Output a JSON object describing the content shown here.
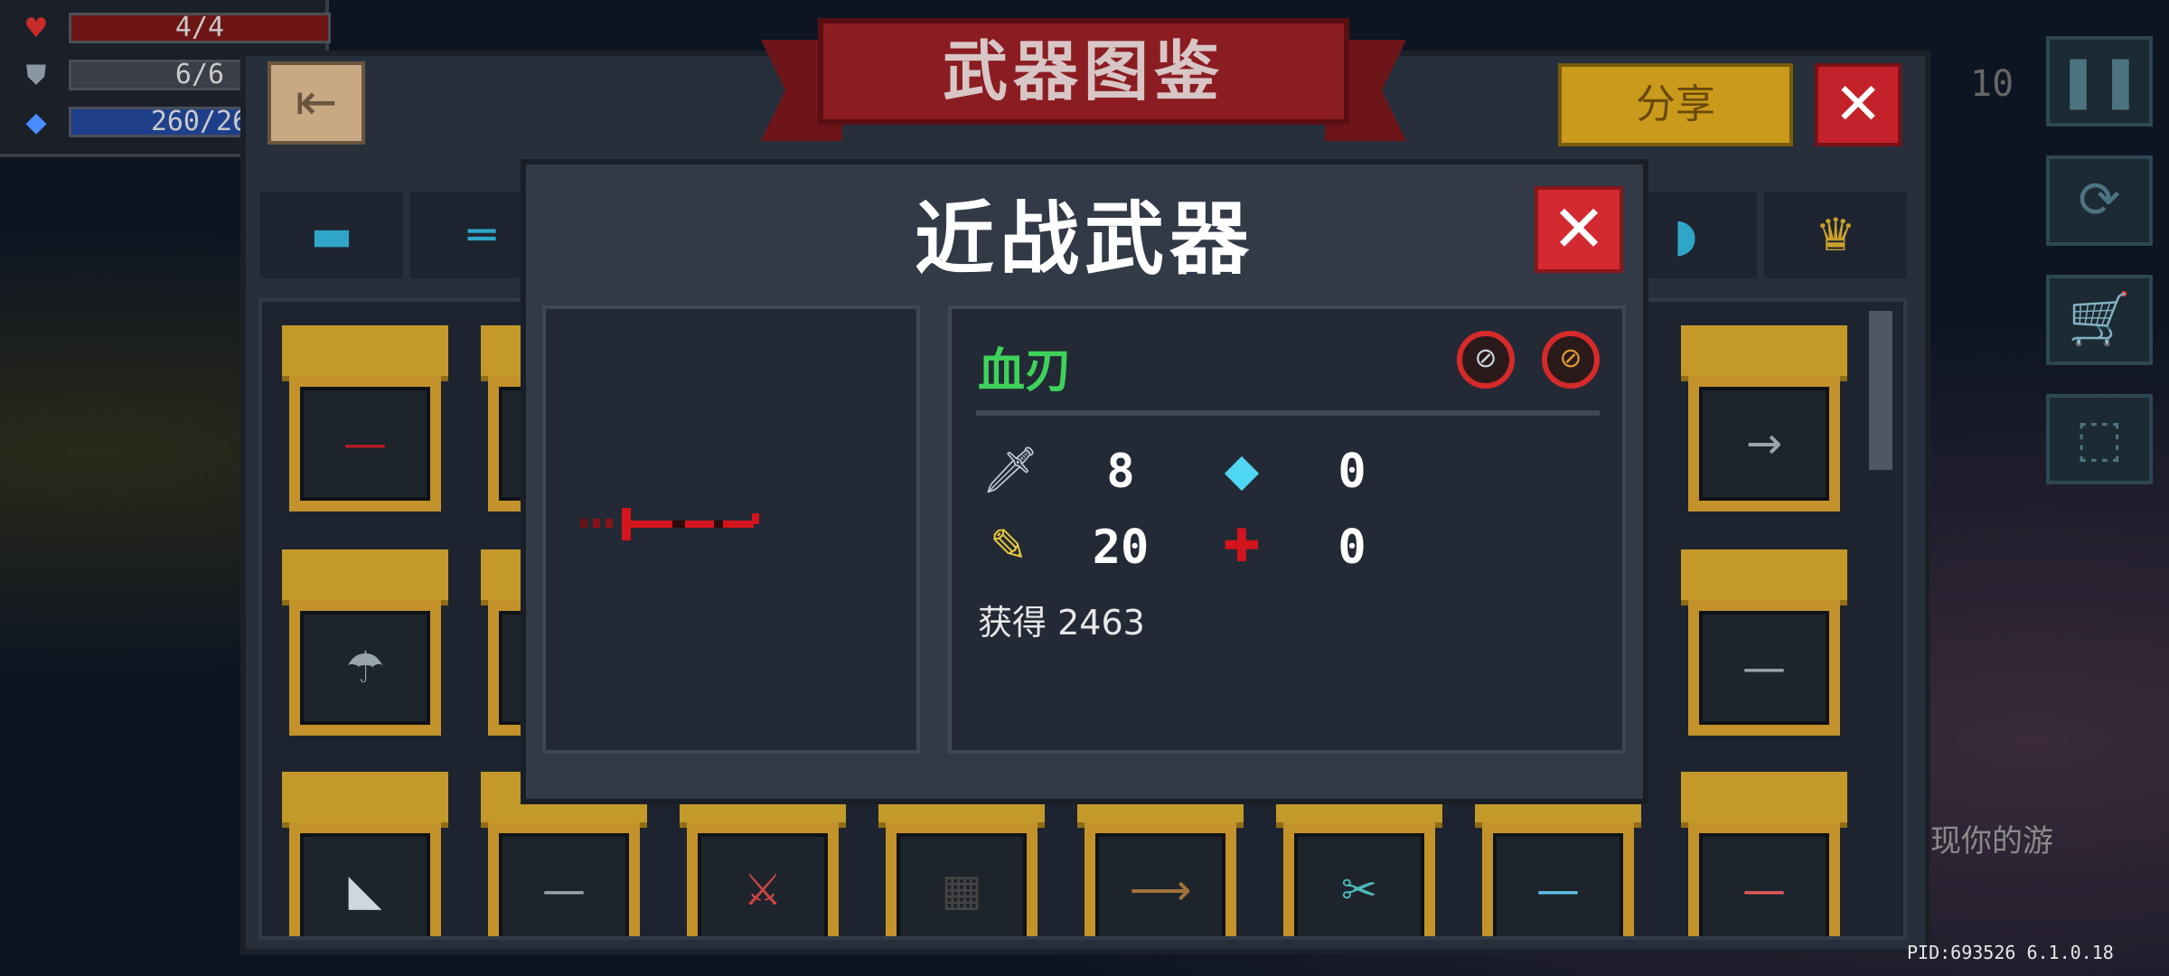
{
  "hud": {
    "hp": "4/4",
    "armor": "6/6",
    "energy": "260/26"
  },
  "coin_counter_partial": "10",
  "background_hint": "现你的游",
  "pid_text": "PID:693526 6.1.0.18",
  "book": {
    "title": "武器图鉴",
    "share_label": "分享",
    "close_symbol": "✕"
  },
  "modal": {
    "title": "近战武器",
    "close_symbol": "✕",
    "weapon_name": "血刃",
    "stats": {
      "attack": "8",
      "energy_cost": "0",
      "critical": "20",
      "spread": "0"
    },
    "obtained_label": "获得",
    "obtained_count": "2463",
    "name_color": "#3fd25a",
    "blade_color": "#d4141c"
  }
}
